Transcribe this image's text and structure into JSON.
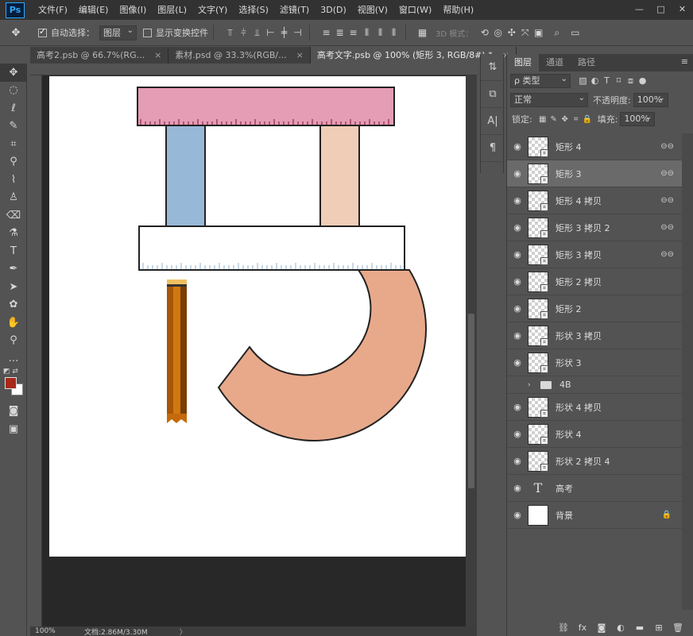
{
  "app": {
    "logo": "Ps"
  },
  "menu": [
    "文件(F)",
    "编辑(E)",
    "图像(I)",
    "图层(L)",
    "文字(Y)",
    "选择(S)",
    "滤镜(T)",
    "3D(D)",
    "视图(V)",
    "窗口(W)",
    "帮助(H)"
  ],
  "window_controls": {
    "minimize": "—",
    "restore": "□",
    "close": "✕"
  },
  "options": {
    "auto_select_label": "自动选择：",
    "auto_select_checked": true,
    "auto_select_value": "图层",
    "show_transform_label": "显示变换控件",
    "show_transform_checked": false,
    "mode_3d_label": "3D 模式："
  },
  "tabs": [
    {
      "label": "高考2.psb @ 66.7%(RG...",
      "close": "×",
      "active": false
    },
    {
      "label": "素材.psd @ 33.3%(RGB/...",
      "close": "×",
      "active": false
    },
    {
      "label": "高考文字.psb @ 100% (矩形 3, RGB/8#) *",
      "close": "×",
      "active": true
    }
  ],
  "status": {
    "zoom": "100%",
    "doc_size": "文档:2.86M/3.30M",
    "arrow": "〉"
  },
  "layers_panel": {
    "tabs": [
      "图层",
      "通道",
      "路径"
    ],
    "menu_icon": "≡",
    "filter_kind": "ρ 类型",
    "blend_mode": "正常",
    "opacity_label": "不透明度:",
    "opacity_value": "100%",
    "lock_label": "锁定:",
    "fill_label": "填充:",
    "fill_value": "100%",
    "layers": [
      {
        "name": "矩形 4",
        "thumb": "checker",
        "badge": true,
        "link": true,
        "selected": false
      },
      {
        "name": "矩形 3",
        "thumb": "checker",
        "badge": true,
        "link": true,
        "selected": true
      },
      {
        "name": "矩形 4 拷贝",
        "thumb": "checker",
        "badge": true,
        "link": true,
        "selected": false
      },
      {
        "name": "矩形 3 拷贝 2",
        "thumb": "checker",
        "badge": true,
        "link": true,
        "selected": false
      },
      {
        "name": "矩形 3 拷贝",
        "thumb": "checker",
        "badge": true,
        "link": true,
        "selected": false
      },
      {
        "name": "矩形 2 拷贝",
        "thumb": "checker",
        "badge": true,
        "link": false,
        "selected": false
      },
      {
        "name": "矩形 2",
        "thumb": "checker",
        "badge": true,
        "link": false,
        "selected": false
      },
      {
        "name": "形状 3 拷贝",
        "thumb": "checker",
        "badge": true,
        "link": false,
        "selected": false
      },
      {
        "name": "形状 3",
        "thumb": "checker",
        "badge": true,
        "link": false,
        "selected": false
      },
      {
        "name": "4B",
        "type": "group",
        "selected": false
      },
      {
        "name": "形状 4 拷贝",
        "thumb": "checker",
        "badge": true,
        "link": false,
        "selected": false
      },
      {
        "name": "形状 4",
        "thumb": "checker",
        "badge": true,
        "link": false,
        "selected": false
      },
      {
        "name": "形状 2 拷贝 4",
        "thumb": "checker",
        "badge": true,
        "link": false,
        "selected": false
      },
      {
        "name": "高考",
        "thumb": "text",
        "badge": false,
        "link": false,
        "selected": false
      },
      {
        "name": "背景",
        "thumb": "plain",
        "badge": false,
        "link": false,
        "lock": true,
        "selected": false
      }
    ]
  },
  "colors": {
    "foreground": "#a8281a",
    "background": "#ffffff",
    "ruler_pink": "#e59cb5",
    "blue_bar": "#98b8d8",
    "peach_bar": "#f0cdb7",
    "hook": "#e8a98b",
    "pencil": "#c46a0c"
  }
}
